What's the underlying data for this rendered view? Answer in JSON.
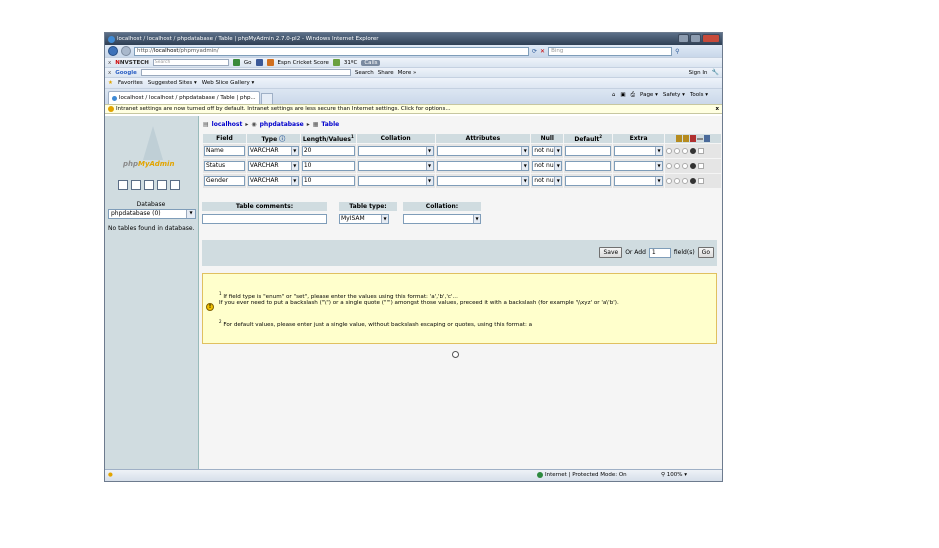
{
  "window": {
    "title": "localhost / localhost / phpdatabase / Table | phpMyAdmin 2.7.0-pl2 - Windows Internet Explorer"
  },
  "addressbar": {
    "url_prefix": "http://",
    "url_host": "localhost",
    "url_path": "/phpmyadmin/",
    "search_placeholder": "Bing"
  },
  "nvstech_toolbar": {
    "close": "x",
    "brand": "NVSTECH",
    "search_placeholder": "Search",
    "go_label": "Go",
    "score_label": "Espn Cricket Score",
    "temperature": "31ºC",
    "calls_label": "Calls"
  },
  "google_toolbar": {
    "close": "x",
    "brand": "Google",
    "search_label": "Search",
    "share_label": "Share",
    "more_label": "More »",
    "signin_label": "Sign In"
  },
  "favorites": {
    "favorites_label": "Favorites",
    "suggested_sites": "Suggested Sites ▾",
    "web_slice_gallery": "Web Slice Gallery ▾"
  },
  "tabs": {
    "active_tab": "localhost / localhost / phpdatabase / Table | php...",
    "tools": [
      "Page ▾",
      "Safety ▾",
      "Tools ▾"
    ]
  },
  "infobar": {
    "message": "Intranet settings are now turned off by default. Intranet settings are less secure than Internet settings. Click for options...",
    "close": "x"
  },
  "left_frame": {
    "logo_php": "php",
    "logo_myadmin": "MyAdmin",
    "database_label": "Database",
    "database_value": "phpdatabase (0)",
    "no_tables": "No tables found in database."
  },
  "breadcrumb": {
    "server": "localhost",
    "database": "phpdatabase",
    "table": "Table",
    "separator": "▸"
  },
  "fields_table": {
    "headers": {
      "field": "Field",
      "type": "Type",
      "length": "Length/Values",
      "length_sup": "1",
      "collation": "Collation",
      "attributes": "Attributes",
      "null": "Null",
      "default": "Default",
      "default_sup": "2",
      "extra": "Extra"
    },
    "rows": [
      {
        "field": "Name",
        "type": "VARCHAR",
        "length": "20",
        "collation": "",
        "attributes": "",
        "null": "not null",
        "default": "",
        "extra": ""
      },
      {
        "field": "Status",
        "type": "VARCHAR",
        "length": "10",
        "collation": "",
        "attributes": "",
        "null": "not null",
        "default": "",
        "extra": ""
      },
      {
        "field": "Gender",
        "type": "VARCHAR",
        "length": "10",
        "collation": "",
        "attributes": "",
        "null": "not null",
        "default": "",
        "extra": ""
      }
    ]
  },
  "table_options": {
    "comments_label": "Table comments:",
    "comments_value": "",
    "type_label": "Table type:",
    "type_value": "MyISAM",
    "collation_label": "Collation:",
    "collation_value": ""
  },
  "save_bar": {
    "save_label": "Save",
    "or_add_label": "Or Add",
    "add_count": "1",
    "fields_label": "field(s)",
    "go_label": "Go"
  },
  "notes": {
    "note1_num": "1",
    "note1": "If field type is \"enum\" or \"set\", please enter the values using this format: 'a','b','c'...",
    "note1b": "If you ever need to put a backslash (\"\\\") or a single quote (\"'\") amongst those values, preceed it with a backslash (for example '\\\\xyz' or 'a\\'b').",
    "note2_num": "2",
    "note2": "For default values, please enter just a single value, without backslash escaping or quotes, using this format: a"
  },
  "statusbar": {
    "zone": "Internet | Protected Mode: On",
    "zoom": "100%"
  }
}
